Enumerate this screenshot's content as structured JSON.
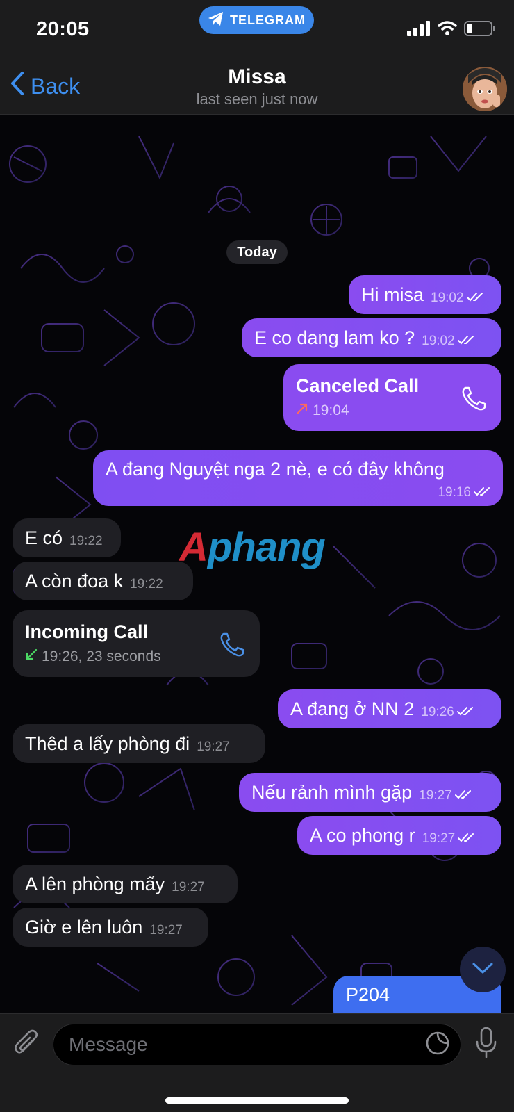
{
  "status_bar": {
    "time": "20:05",
    "app_pill": "TELEGRAM"
  },
  "header": {
    "back_label": "Back",
    "title": "Missa",
    "subtitle": "last seen just now"
  },
  "chat": {
    "date_label": "Today",
    "messages": [
      {
        "text": "Hi misa",
        "time": "19:02"
      },
      {
        "text": "E co dang lam ko ?",
        "time": "19:02"
      },
      {
        "call_title": "Canceled Call",
        "time": "19:04"
      },
      {
        "text": "A đang Nguyệt nga 2 nè, e có đây không",
        "time": "19:16"
      },
      {
        "text": "E có",
        "time": "19:22"
      },
      {
        "text": "A còn đoa k",
        "time": "19:22"
      },
      {
        "call_title": "Incoming Call",
        "time": "19:26, 23 seconds"
      },
      {
        "text": "A đang ở NN 2",
        "time": "19:26"
      },
      {
        "text": "Thêd a lấy phòng đi",
        "time": "19:27"
      },
      {
        "text": "Nếu rảnh mình gặp",
        "time": "19:27"
      },
      {
        "text": "A co phong r",
        "time": "19:27"
      },
      {
        "text": "A lên phòng mấy",
        "time": "19:27"
      },
      {
        "text": "Giờ e lên luôn",
        "time": "19:27"
      },
      {
        "text": "P204"
      }
    ],
    "watermark": {
      "first": "A",
      "rest": "phang"
    }
  },
  "input": {
    "placeholder": "Message"
  },
  "colors": {
    "accent": "#3e8ff0",
    "outgoing": "#8a4cf0",
    "incoming": "#1f1f24"
  }
}
